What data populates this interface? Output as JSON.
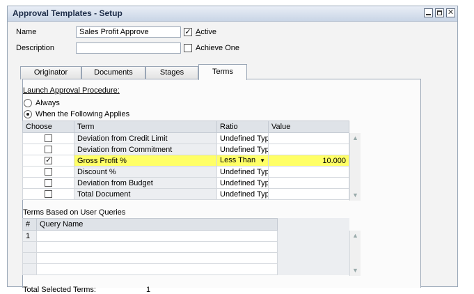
{
  "window": {
    "title": "Approval Templates - Setup"
  },
  "header": {
    "name_label": "Name",
    "name_value": "Sales Profit Approve",
    "active_label": "Active",
    "description_label": "Description",
    "description_value": "",
    "achieve_one_label": "Achieve One"
  },
  "tabs": [
    {
      "label": "Originator"
    },
    {
      "label": "Documents"
    },
    {
      "label": "Stages"
    },
    {
      "label": "Terms"
    }
  ],
  "terms_tab": {
    "launch_label": "Launch Approval Procedure:",
    "always_label": "Always",
    "when_label": "When the Following Applies",
    "grid": {
      "columns": [
        "Choose",
        "Term",
        "Ratio",
        "Value"
      ],
      "rows": [
        {
          "checked": false,
          "term": "Deviation from Credit Limit",
          "ratio": "Undefined Type",
          "value": ""
        },
        {
          "checked": false,
          "term": "Deviation from Commitment",
          "ratio": "Undefined Type",
          "value": ""
        },
        {
          "checked": true,
          "term": "Gross Profit %",
          "ratio": "Less Than",
          "value": "10.000"
        },
        {
          "checked": false,
          "term": "Discount %",
          "ratio": "Undefined Type",
          "value": ""
        },
        {
          "checked": false,
          "term": "Deviation from Budget",
          "ratio": "Undefined Type",
          "value": ""
        },
        {
          "checked": false,
          "term": "Total Document",
          "ratio": "Undefined Type",
          "value": ""
        }
      ]
    },
    "queries_label": "Terms Based on User Queries",
    "query_grid": {
      "columns": [
        "#",
        "Query Name"
      ],
      "rows": [
        {
          "num": "1",
          "name": ""
        }
      ]
    },
    "total_label": "Total Selected Terms:",
    "total_value": "1"
  },
  "colors": {
    "highlight": "#ffff55",
    "titlebar_text": "#1c2c48"
  }
}
